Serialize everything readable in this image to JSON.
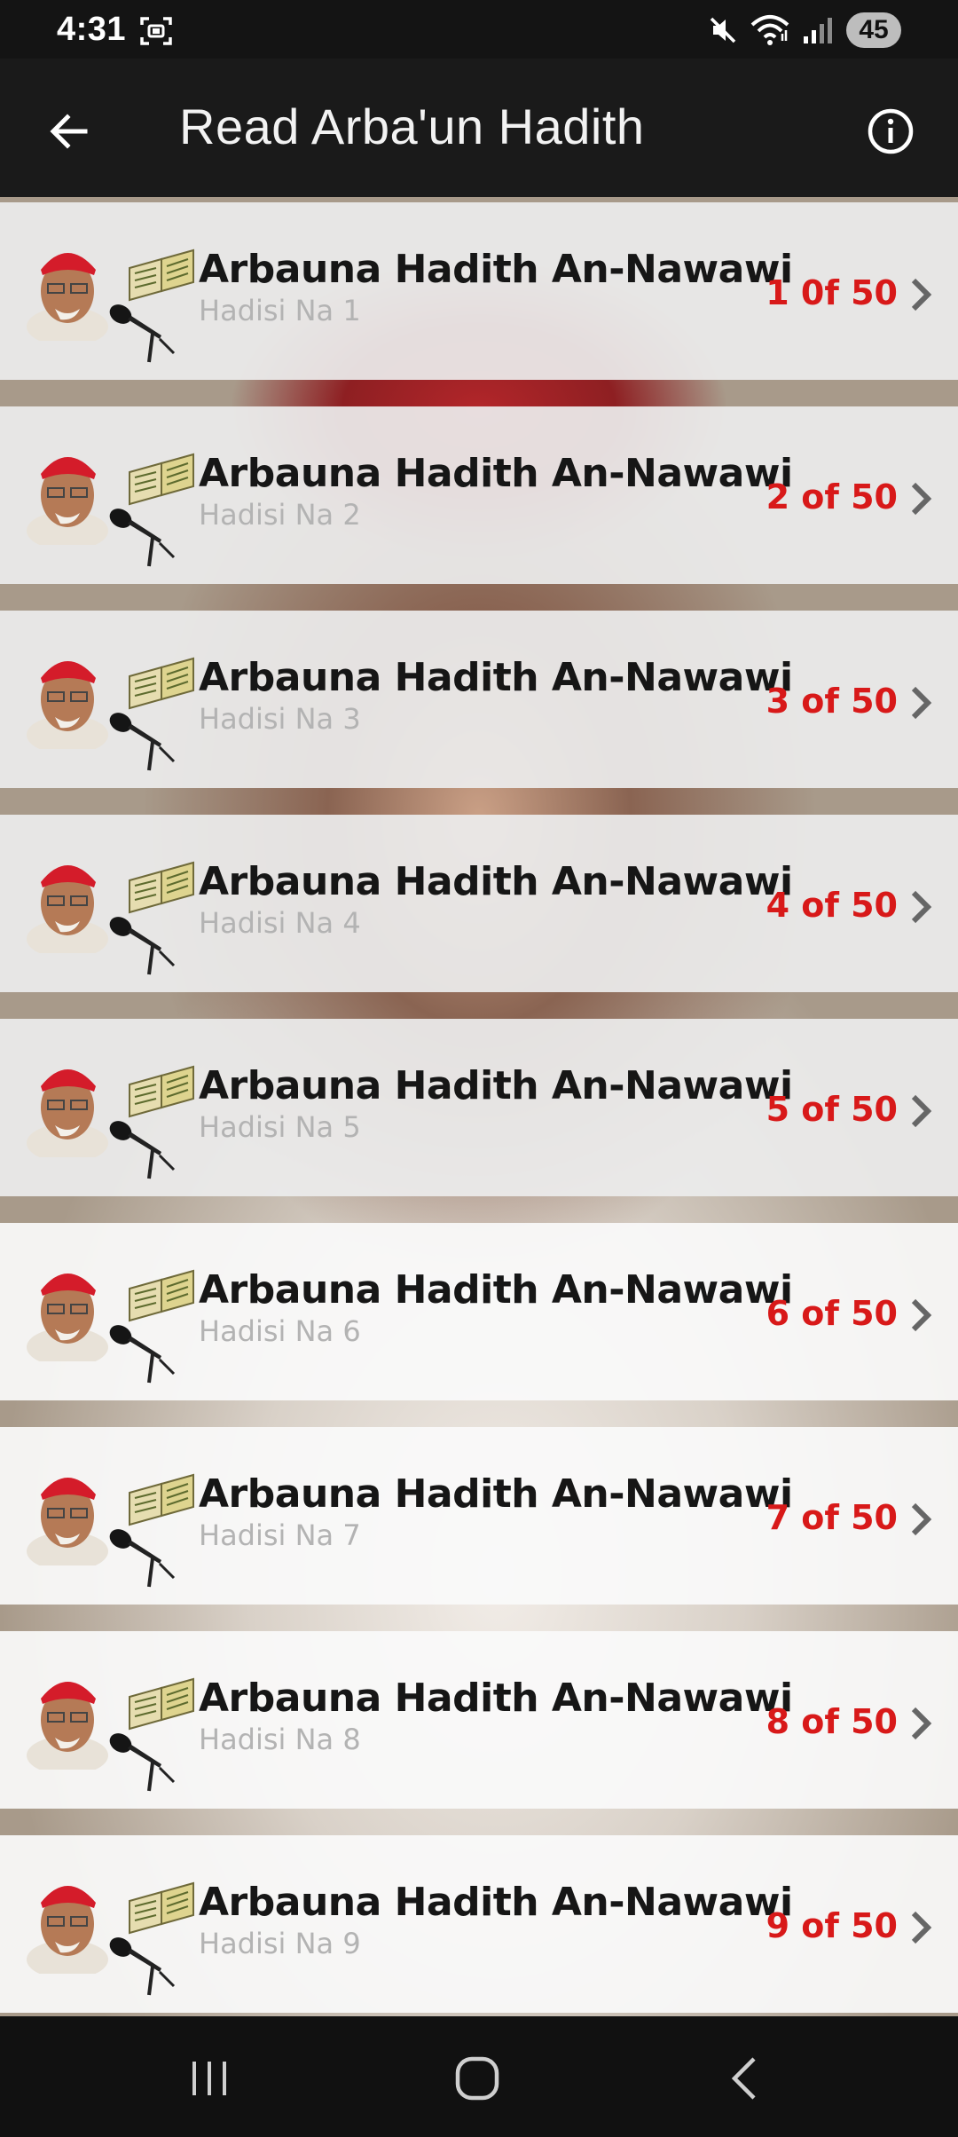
{
  "status_bar": {
    "time": "4:31",
    "battery": "45",
    "icons": [
      "screenshot-icon",
      "mute-icon",
      "wifi-icon",
      "signal-icon"
    ]
  },
  "app_bar": {
    "title": "Read Arba'un Hadith",
    "back_icon": "arrow-left-icon",
    "info_icon": "info-icon"
  },
  "theme": {
    "accent": "#d81919",
    "title_color": "#161616",
    "subtitle_color": "#b3b3b3",
    "app_bar_bg": "#1a1a1a"
  },
  "list": {
    "items": [
      {
        "title": "Arbauna Hadith An-Nawawi",
        "subtitle": "Hadisi Na 1",
        "counter": "1 0f 50"
      },
      {
        "title": "Arbauna Hadith An-Nawawi",
        "subtitle": "Hadisi Na 2",
        "counter": "2 of 50"
      },
      {
        "title": "Arbauna Hadith An-Nawawi",
        "subtitle": "Hadisi Na 3",
        "counter": "3 of 50"
      },
      {
        "title": "Arbauna Hadith An-Nawawi",
        "subtitle": "Hadisi Na 4",
        "counter": "4 of 50"
      },
      {
        "title": "Arbauna Hadith An-Nawawi",
        "subtitle": "Hadisi Na 5",
        "counter": "5 of 50"
      },
      {
        "title": "Arbauna Hadith An-Nawawi",
        "subtitle": "Hadisi Na 6",
        "counter": "6 of 50"
      },
      {
        "title": "Arbauna Hadith An-Nawawi",
        "subtitle": "Hadisi Na 7",
        "counter": "7 of 50"
      },
      {
        "title": "Arbauna Hadith An-Nawawi",
        "subtitle": "Hadisi Na 8",
        "counter": "8 of 50"
      },
      {
        "title": "Arbauna Hadith An-Nawawi",
        "subtitle": "Hadisi Na 9",
        "counter": "9 of 50"
      }
    ]
  },
  "nav_bar": {
    "icons": [
      "recents-icon",
      "home-icon",
      "back-icon"
    ]
  }
}
